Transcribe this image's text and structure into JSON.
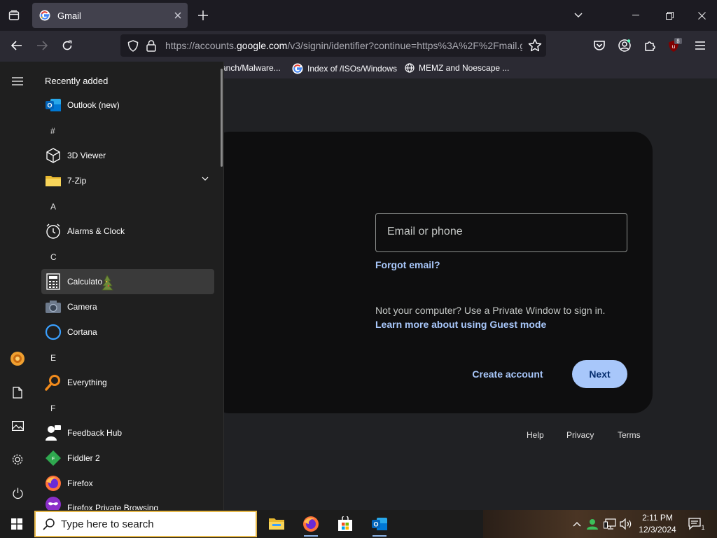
{
  "browser": {
    "tab_title": "Gmail",
    "url_prefix": "https://accounts.",
    "url_domain": "google.com",
    "url_rest": "/v3/signin/identifier?continue=https%3A%2F%2Fmail.go",
    "extension_badge": "8",
    "bookmarks": [
      "anch/Malware...",
      "Index of /ISOs/Windows",
      "MEMZ and Noescape ..."
    ]
  },
  "page": {
    "email_placeholder": "Email or phone",
    "forgot_email": "Forgot email?",
    "private_note": "Not your computer? Use a Private Window to sign in.",
    "guest_link": "Learn more about using Guest mode",
    "create_account": "Create account",
    "next": "Next",
    "footer": {
      "help": "Help",
      "privacy": "Privacy",
      "terms": "Terms"
    },
    "colors": {
      "accent": "#a8c7fa",
      "button_text": "#062e6f",
      "card_bg": "#0e0e0f"
    }
  },
  "start_menu": {
    "recent_heading": "Recently added",
    "recent_app": "Outlook (new)",
    "letters": {
      "hash": "#",
      "a": "A",
      "c": "C",
      "e": "E",
      "f": "F"
    },
    "apps": {
      "viewer3d": "3D Viewer",
      "zip": "7-Zip",
      "alarms": "Alarms & Clock",
      "calculator": "Calculato",
      "camera": "Camera",
      "cortana": "Cortana",
      "everything": "Everything",
      "feedback": "Feedback Hub",
      "fiddler": "Fiddler 2",
      "firefox": "Firefox",
      "firefox_private": "Firefox Private Browsing"
    }
  },
  "taskbar": {
    "search_placeholder": "Type here to search",
    "time": "2:11 PM",
    "date": "12/3/2024",
    "notification_count": "1"
  }
}
